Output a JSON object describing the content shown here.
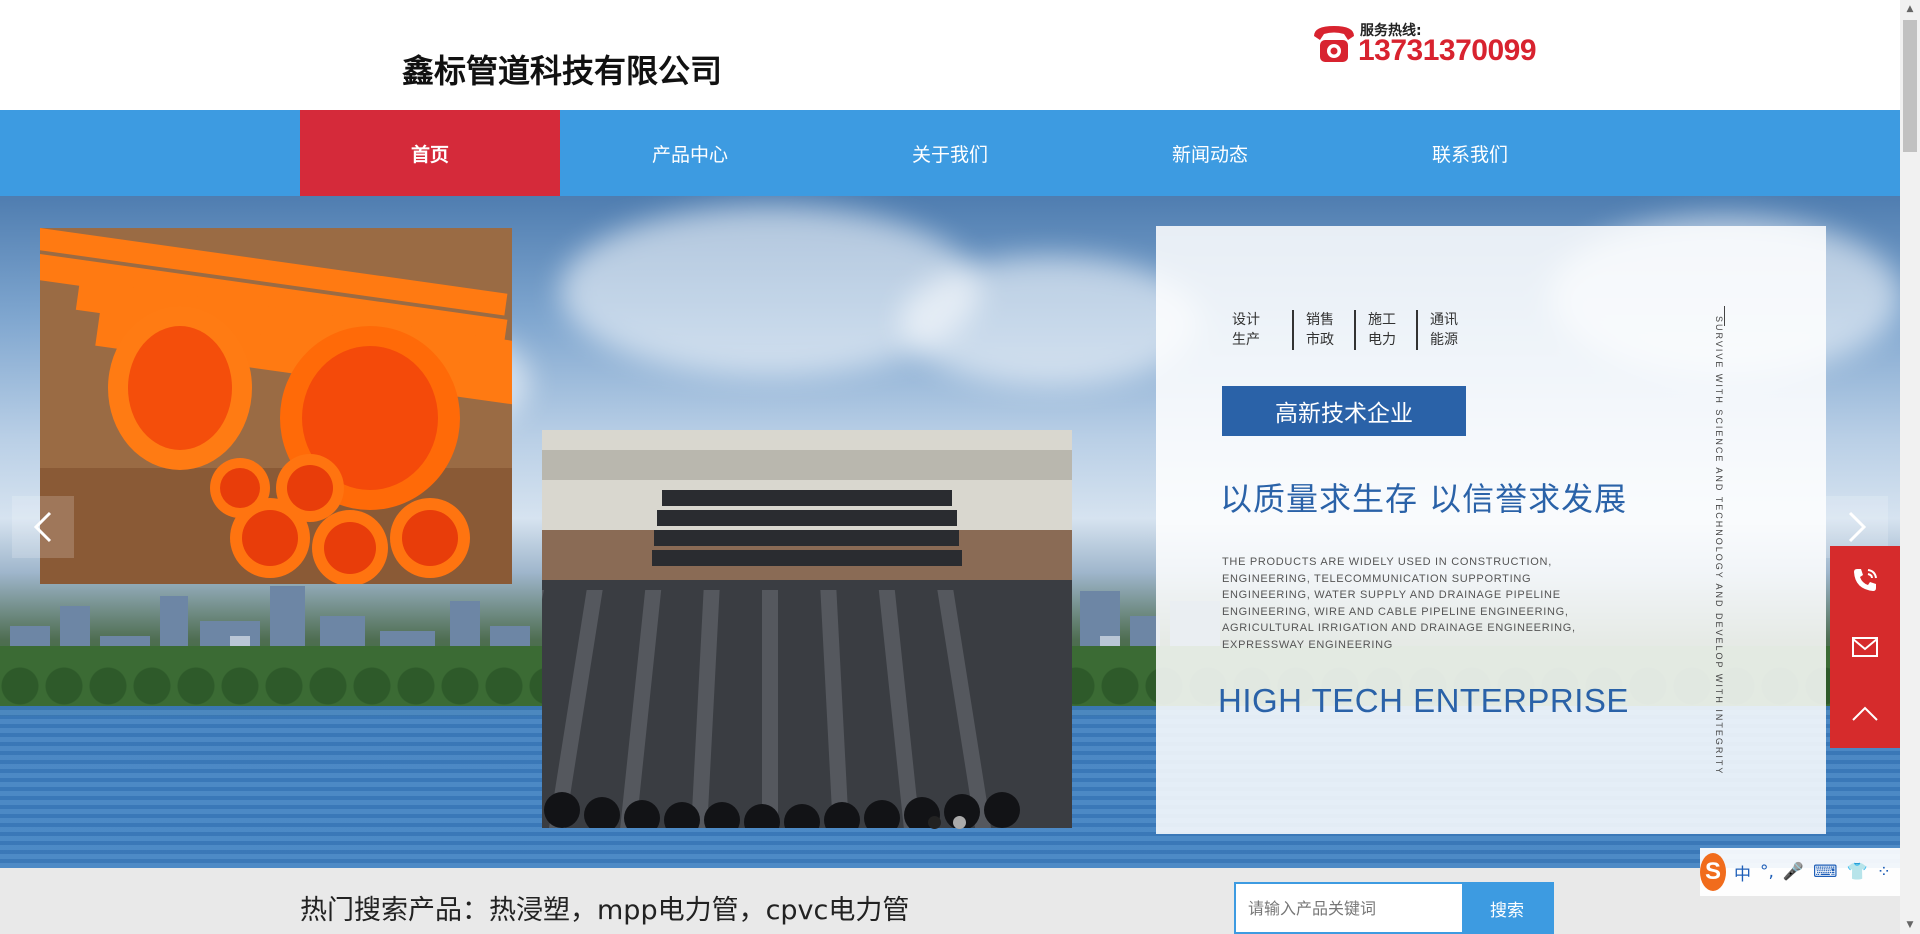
{
  "header": {
    "company_name": "鑫标管道科技有限公司",
    "hotline_label": "服务热线:",
    "hotline_number": "13731370099"
  },
  "nav": {
    "items": [
      {
        "label": "首页",
        "active": true
      },
      {
        "label": "产品中心",
        "active": false
      },
      {
        "label": "关于我们",
        "active": false
      },
      {
        "label": "新闻动态",
        "active": false
      },
      {
        "label": "联系我们",
        "active": false
      }
    ]
  },
  "banner": {
    "tags": [
      {
        "line1": "设计",
        "line2": "生产"
      },
      {
        "line1": "销售",
        "line2": "市政"
      },
      {
        "line1": "施工",
        "line2": "电力"
      },
      {
        "line1": "通讯",
        "line2": "能源"
      }
    ],
    "badge": "高新技术企业",
    "slogan": "以质量求生存  以信誉求发展",
    "description": "THE PRODUCTS ARE WIDELY USED IN CONSTRUCTION, ENGINEERING, TELECOMMUNICATION SUPPORTING ENGINEERING, WATER SUPPLY AND DRAINAGE PIPELINE ENGINEERING, WIRE AND CABLE PIPELINE ENGINEERING, AGRICULTURAL IRRIGATION AND DRAINAGE ENGINEERING, EXPRESSWAY ENGINEERING",
    "enterprise": "HIGH TECH ENTERPRISE",
    "vertical_text": "SURVIVE WITH SCIENCE AND TECHNOLOGY AND DEVELOP WITH INTEGRITY",
    "active_slide": 1,
    "slide_count": 2
  },
  "search": {
    "hot_label": "热门搜索产品：热浸塑，mpp电力管，cpvc电力管",
    "placeholder": "请输入产品关键词",
    "button": "搜索"
  },
  "ime": {
    "logo": "S",
    "items": [
      "中",
      "°,",
      "🎤",
      "⌨",
      "👕",
      "⁘"
    ]
  },
  "colors": {
    "nav_bg": "#3d9be1",
    "nav_active": "#d52a3a",
    "hotline": "#d8232f",
    "brand_blue": "#2a62a8",
    "side_float": "#d62b2c"
  }
}
